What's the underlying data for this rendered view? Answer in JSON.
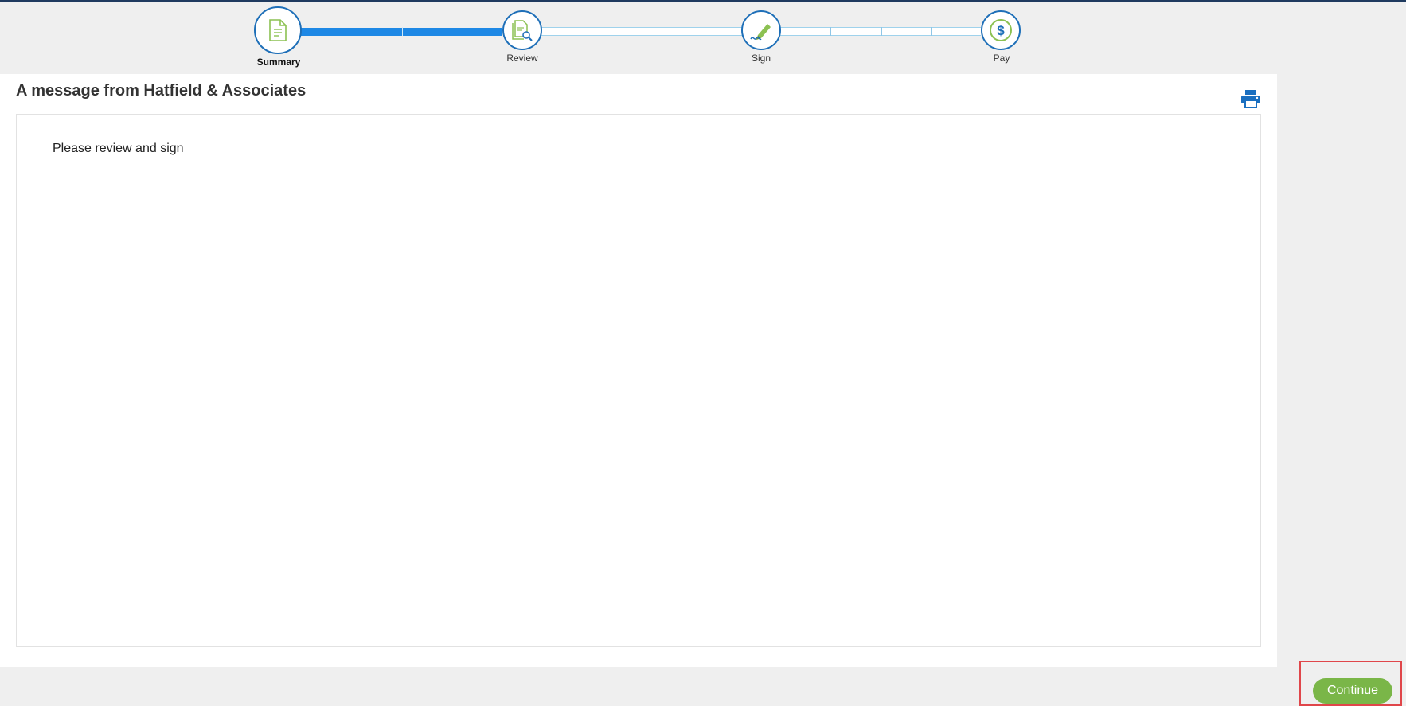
{
  "steps": [
    {
      "label": "Summary",
      "icon": "document-icon",
      "state": "current"
    },
    {
      "label": "Review",
      "icon": "document-search-icon",
      "state": "pending"
    },
    {
      "label": "Sign",
      "icon": "pen-signature-icon",
      "state": "pending"
    },
    {
      "label": "Pay",
      "icon": "dollar-icon",
      "state": "pending"
    }
  ],
  "progress_fraction": 0.28,
  "message": {
    "title": "A message from Hatfield & Associates",
    "body": "Please review and sign"
  },
  "actions": {
    "print_icon": "printer-icon",
    "continue_label": "Continue"
  },
  "colors": {
    "accent_blue": "#1e88e5",
    "circle_border": "#1e6fb8",
    "icon_green": "#8cc152",
    "continue_green": "#7ab648",
    "highlight_red": "#e0464a"
  }
}
